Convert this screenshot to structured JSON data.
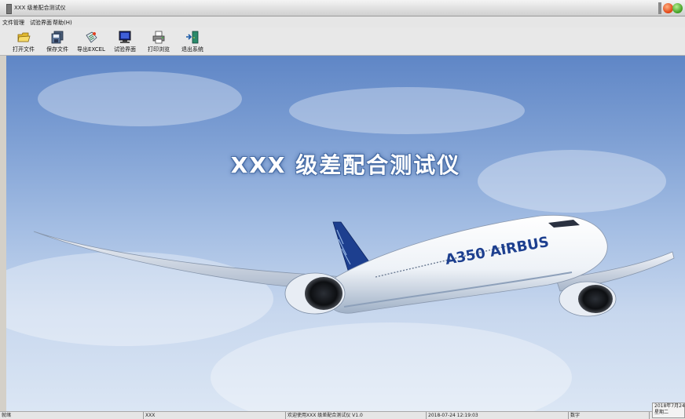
{
  "window": {
    "title": "XXX 级差配合测试仪"
  },
  "menu": [
    "文件管理",
    "试验界面",
    "帮助(H)"
  ],
  "toolbar": [
    {
      "label": "打开文件",
      "icon": "folder-open-icon"
    },
    {
      "label": "保存文件",
      "icon": "save-disk-icon"
    },
    {
      "label": "导出EXCEL",
      "icon": "export-excel-icon"
    },
    {
      "label": "试验界面",
      "icon": "monitor-icon"
    },
    {
      "label": "打印浏览",
      "icon": "printer-icon"
    },
    {
      "label": "退出系统",
      "icon": "exit-door-icon"
    }
  ],
  "main": {
    "banner_title": "XXX 级差配合测试仪",
    "plane_text": "A350 AIRBUS"
  },
  "status": {
    "ready": "就绪",
    "user": "XXX",
    "welcome": "欢迎使用XXX 级差配合测试仪    V1.0",
    "datetime": "2018-07-24 12:19:03",
    "caps": "数字"
  },
  "clock": {
    "date": "2018年7月24",
    "weekday": "星期二"
  },
  "colors": {
    "sky_top": "#5f86c6",
    "sky_bottom": "#dbe6f4",
    "plane_body": "#f2f5f9",
    "airbus_blue": "#1d3f8f"
  }
}
